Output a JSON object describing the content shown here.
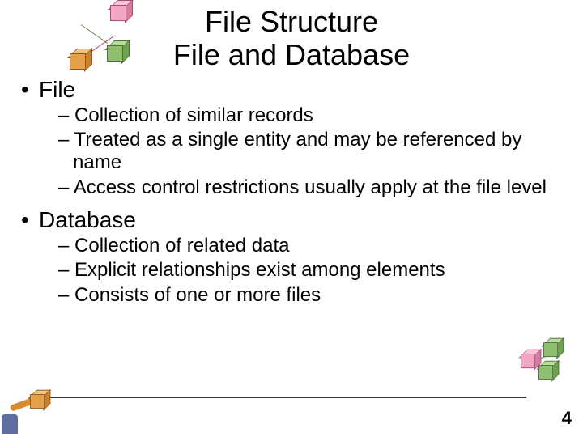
{
  "title": {
    "line1": "File Structure",
    "line2": "File and Database"
  },
  "sections": [
    {
      "heading": "File",
      "items": [
        "Collection of similar records",
        "Treated as a single entity and may be referenced by name",
        "Access control restrictions usually apply at the file level"
      ]
    },
    {
      "heading": "Database",
      "items": [
        "Collection of related data",
        "Explicit relationships exist among elements",
        "Consists of one or more files"
      ]
    }
  ],
  "page_number": "4"
}
